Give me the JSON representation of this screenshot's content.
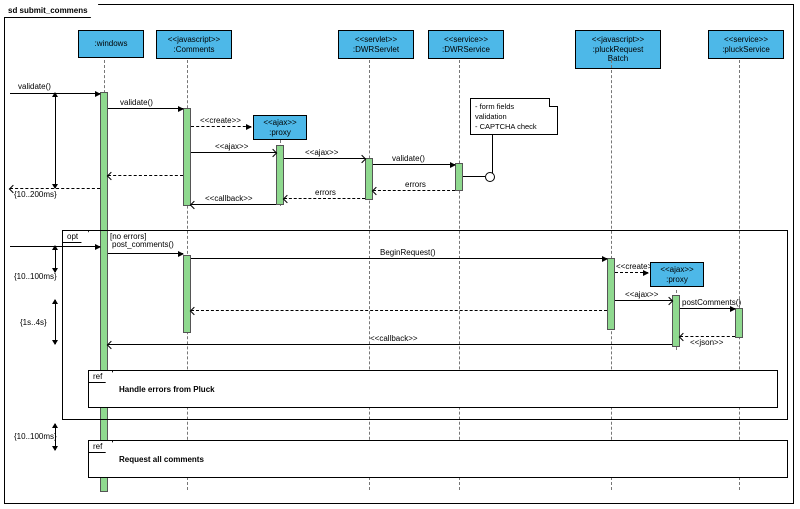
{
  "diagram": {
    "title": "sd submit_commens",
    "participants": {
      "windows": {
        "stereotype": "",
        "name": ":windows"
      },
      "comments": {
        "stereotype": "<<javascript>>",
        "name": ":Comments"
      },
      "proxy1": {
        "stereotype": "<<ajax>>",
        "name": ":proxy"
      },
      "dwrservlet": {
        "stereotype": "<<servlet>>",
        "name": ":DWRServlet"
      },
      "dwrservice": {
        "stereotype": "<<service>>",
        "name": ":DWRService"
      },
      "pluckbatch": {
        "stereotype": "<<javascript>>",
        "name": ":pluckRequest\nBatch"
      },
      "proxy2": {
        "stereotype": "<<ajax>>",
        "name": ":proxy"
      },
      "pluckservice": {
        "stereotype": "<<service>>",
        "name": ":pluckService"
      }
    },
    "messages": {
      "validate_in": "validate()",
      "validate_to_comments": "validate()",
      "create1": "<<create>>",
      "ajax1": "<<ajax>>",
      "ajax2": "<<ajax>>",
      "validate_svc": "validate()",
      "errors1": "errors",
      "errors2": "errors",
      "callback1": "<<callback>>",
      "dashed_out": "",
      "post_comments": "post_comments()",
      "begin_request": "BeginRequest()",
      "create2": "<<create>>",
      "ajax3": "<<ajax>>",
      "post_comments2": "postComments()",
      "json": "<<json>>",
      "callback2": "<<callback>>"
    },
    "fragments": {
      "opt": {
        "label": "opt",
        "guard": "[no errors]"
      },
      "ref1": {
        "label": "ref",
        "text": "Handle errors from Pluck"
      },
      "ref2": {
        "label": "ref",
        "text": "Request all comments"
      }
    },
    "note": {
      "line1": "- form fields",
      "line2": "  validation",
      "line3": "- CAPTCHA check"
    },
    "time_constraints": {
      "t1": "{10..200ms}",
      "t2": "{10..100ms}",
      "t3": "{1s..4s}",
      "t4": "{10..100ms}"
    }
  },
  "chart_data": {
    "type": "sequence-diagram",
    "title": "sd submit_commens",
    "participants": [
      {
        "id": "ext",
        "name": "(external actor)"
      },
      {
        "id": "windows",
        "name": ":windows"
      },
      {
        "id": "comments",
        "name": ":Comments",
        "stereotype": "javascript"
      },
      {
        "id": "proxy1",
        "name": ":proxy",
        "stereotype": "ajax",
        "created": true
      },
      {
        "id": "dwrservlet",
        "name": ":DWRServlet",
        "stereotype": "servlet"
      },
      {
        "id": "dwrservice",
        "name": ":DWRService",
        "stereotype": "service"
      },
      {
        "id": "pluckbatch",
        "name": ":pluckRequestBatch",
        "stereotype": "javascript"
      },
      {
        "id": "proxy2",
        "name": ":proxy",
        "stereotype": "ajax",
        "created": true
      },
      {
        "id": "pluckservice",
        "name": ":pluckService",
        "stereotype": "service"
      }
    ],
    "messages": [
      {
        "from": "ext",
        "to": "windows",
        "label": "validate()",
        "type": "sync"
      },
      {
        "from": "windows",
        "to": "comments",
        "label": "validate()",
        "type": "sync"
      },
      {
        "from": "comments",
        "to": "proxy1",
        "label": "<<create>>",
        "type": "create"
      },
      {
        "from": "comments",
        "to": "proxy1",
        "label": "<<ajax>>",
        "type": "async"
      },
      {
        "from": "proxy1",
        "to": "dwrservlet",
        "label": "<<ajax>>",
        "type": "async"
      },
      {
        "from": "dwrservlet",
        "to": "dwrservice",
        "label": "validate()",
        "type": "sync"
      },
      {
        "from": "dwrservice",
        "to": "dwrservlet",
        "label": "errors",
        "type": "return"
      },
      {
        "from": "dwrservlet",
        "to": "proxy1",
        "label": "errors",
        "type": "return"
      },
      {
        "from": "proxy1",
        "to": "comments",
        "label": "<<callback>>",
        "type": "async"
      },
      {
        "from": "windows",
        "to": "ext",
        "label": "",
        "type": "return"
      },
      {
        "from": "ext",
        "to": "windows",
        "label": "post_comments()",
        "type": "sync",
        "fragment": "opt",
        "guard": "[no errors]"
      },
      {
        "from": "windows",
        "to": "pluckbatch",
        "label": "BeginRequest()",
        "type": "sync",
        "fragment": "opt"
      },
      {
        "from": "pluckbatch",
        "to": "proxy2",
        "label": "<<create>>",
        "type": "create",
        "fragment": "opt"
      },
      {
        "from": "pluckbatch",
        "to": "proxy2",
        "label": "<<ajax>>",
        "type": "async",
        "fragment": "opt"
      },
      {
        "from": "proxy2",
        "to": "pluckservice",
        "label": "postComments()",
        "type": "sync",
        "fragment": "opt"
      },
      {
        "from": "pluckservice",
        "to": "proxy2",
        "label": "<<json>>",
        "type": "return",
        "fragment": "opt"
      },
      {
        "from": "proxy2",
        "to": "windows",
        "label": "<<callback>>",
        "type": "async",
        "fragment": "opt"
      },
      {
        "ref": "Handle errors from Pluck",
        "fragment": "opt"
      },
      {
        "ref": "Request all comments"
      }
    ],
    "notes": [
      {
        "attached_to": "dwrservice",
        "text": "- form fields validation\n- CAPTCHA check"
      }
    ],
    "time_constraints": [
      {
        "label": "{10..200ms}",
        "between": [
          "validate() in",
          "return to ext"
        ]
      },
      {
        "label": "{10..100ms}",
        "between": [
          "post_comments()",
          "BeginRequest()"
        ]
      },
      {
        "label": "{1s..4s}",
        "between": [
          "BeginRequest()",
          "<<callback>>"
        ]
      },
      {
        "label": "{10..100ms}",
        "between": [
          "opt end",
          "Request all comments"
        ]
      }
    ]
  }
}
